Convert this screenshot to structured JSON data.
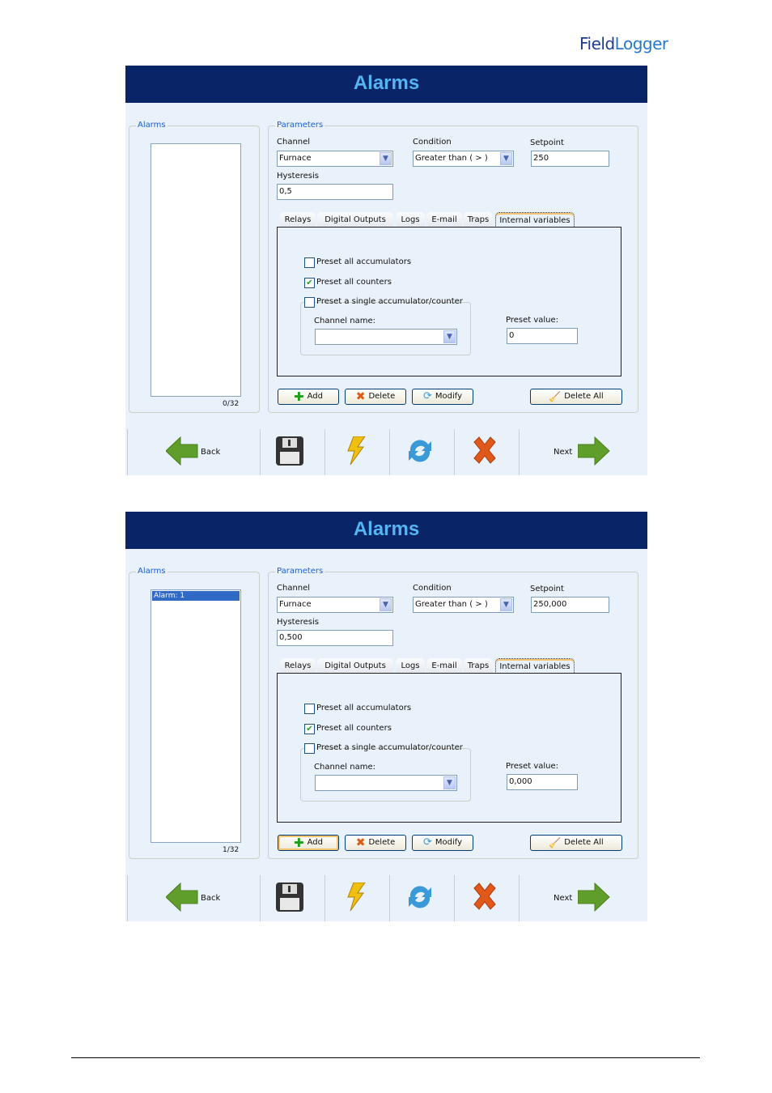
{
  "logo": {
    "text_a": "Field",
    "text_b": "Logger"
  },
  "screens": [
    {
      "title": "Alarms",
      "alarms_group": "Alarms",
      "alarm_items": [],
      "counter": "0/32",
      "params_group": "Parameters",
      "channel_label": "Channel",
      "channel_value": "Furnace",
      "condition_label": "Condition",
      "condition_value": "Greater than ( > )",
      "setpoint_label": "Setpoint",
      "setpoint_value": "250",
      "hysteresis_label": "Hysteresis",
      "hysteresis_value": "0,5",
      "tabs": [
        "Relays",
        "Digital Outputs",
        "Logs",
        "E-mail",
        "Traps",
        "Internal variables"
      ],
      "active_tab": "Internal variables",
      "preset_accumulators": {
        "label": "Preset all accumulators",
        "checked": false
      },
      "preset_counters": {
        "label": "Preset all counters",
        "checked": true
      },
      "preset_single": {
        "label": "Preset a single accumulator/counter",
        "checked": false
      },
      "channel_name_label": "Channel name:",
      "channel_name_value": "",
      "preset_value_label": "Preset value:",
      "preset_value": "0",
      "buttons": {
        "add": "Add",
        "delete": "Delete",
        "modify": "Modify",
        "delete_all": "Delete All"
      },
      "toolbar": {
        "back": "Back",
        "next": "Next"
      }
    },
    {
      "title": "Alarms",
      "alarms_group": "Alarms",
      "alarm_items": [
        "Alarm: 1"
      ],
      "counter": "1/32",
      "params_group": "Parameters",
      "channel_label": "Channel",
      "channel_value": "Furnace",
      "condition_label": "Condition",
      "condition_value": "Greater than ( > )",
      "setpoint_label": "Setpoint",
      "setpoint_value": "250,000",
      "hysteresis_label": "Hysteresis",
      "hysteresis_value": "0,500",
      "tabs": [
        "Relays",
        "Digital Outputs",
        "Logs",
        "E-mail",
        "Traps",
        "Internal variables"
      ],
      "active_tab": "Internal variables",
      "preset_accumulators": {
        "label": "Preset all accumulators",
        "checked": false
      },
      "preset_counters": {
        "label": "Preset all counters",
        "checked": true
      },
      "preset_single": {
        "label": "Preset a single accumulator/counter",
        "checked": false
      },
      "channel_name_label": "Channel name:",
      "channel_name_value": "",
      "preset_value_label": "Preset value:",
      "preset_value": "0,000",
      "buttons": {
        "add": "Add",
        "delete": "Delete",
        "modify": "Modify",
        "delete_all": "Delete All"
      },
      "toolbar": {
        "back": "Back",
        "next": "Next"
      }
    }
  ],
  "colors": {
    "header": "#0a2468",
    "title": "#55b4f2",
    "panel": "#e9f1fa",
    "selection": "#316ac5"
  }
}
